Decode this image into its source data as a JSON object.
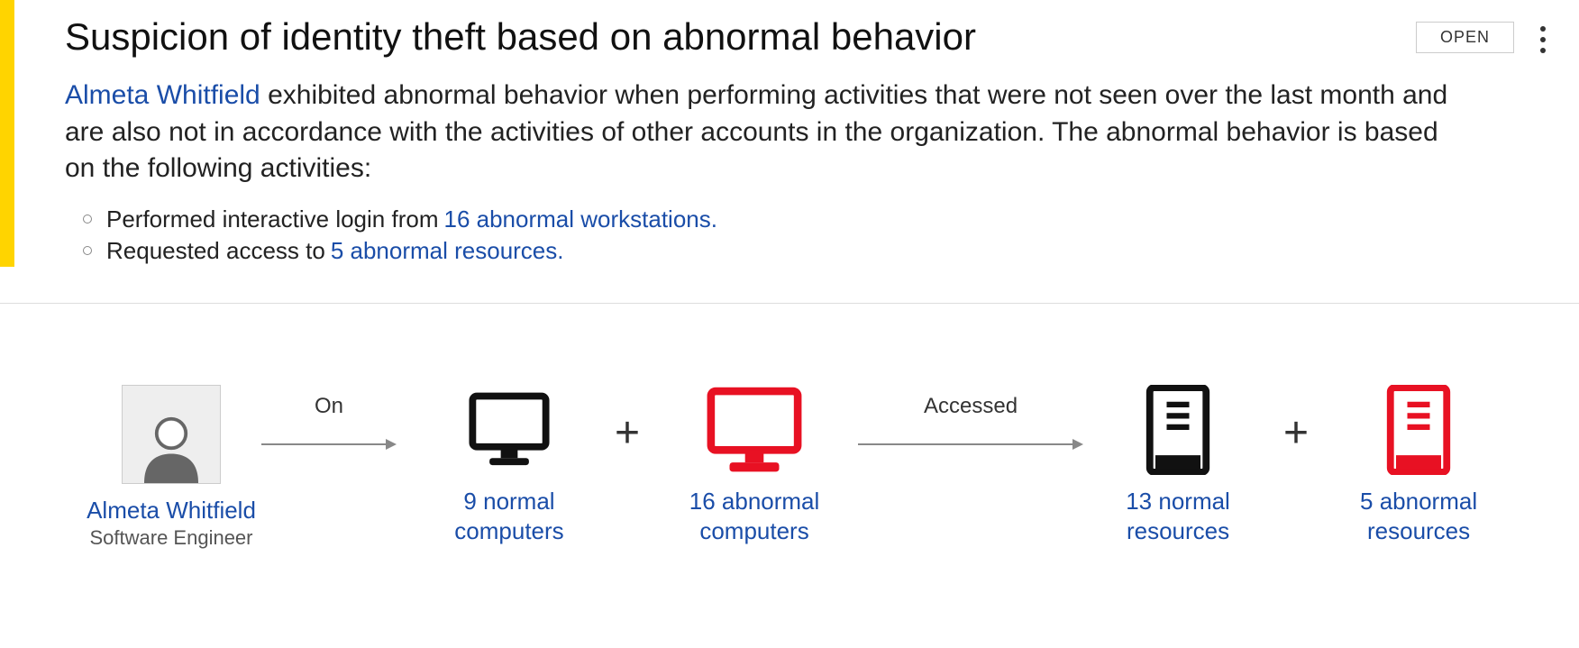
{
  "alert": {
    "title": "Suspicion of identity theft based on abnormal behavior",
    "status": "OPEN",
    "user_link": "Almeta Whitfield",
    "description_rest": " exhibited abnormal behavior when performing activities that were not seen over the last month and are also not in accordance with the activities of other accounts in the organization. The abnormal behavior is based on the following activities:",
    "bullets": [
      {
        "prefix": "Performed interactive login from ",
        "link": "16 abnormal workstations."
      },
      {
        "prefix": "Requested access to ",
        "link": "5 abnormal resources."
      }
    ]
  },
  "diagram": {
    "user": {
      "name": "Almeta Whitfield",
      "role": "Software Engineer"
    },
    "arrow1_label": "On",
    "normal_computers": {
      "line1": "9 normal",
      "line2": "computers"
    },
    "abnormal_computers": {
      "line1": "16  abnormal",
      "line2": "computers"
    },
    "arrow2_label": "Accessed",
    "normal_resources": {
      "line1": "13 normal",
      "line2": "resources"
    },
    "abnormal_resources": {
      "line1": "5  abnormal",
      "line2": "resources"
    },
    "plus": "+"
  }
}
